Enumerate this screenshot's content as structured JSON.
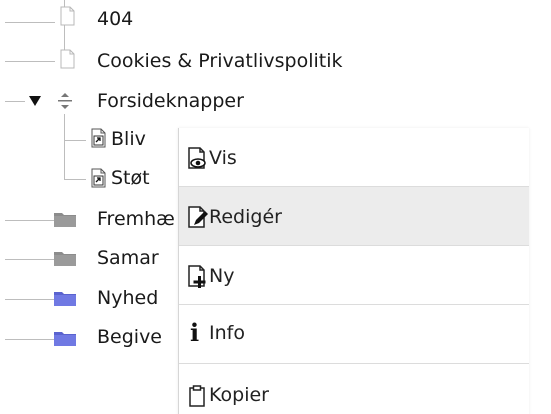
{
  "tree": {
    "items": [
      {
        "label": "404",
        "icon": "page-icon"
      },
      {
        "label": "Cookies & Privatlivspolitik",
        "icon": "page-icon"
      },
      {
        "label": "Forsideknapper",
        "icon": "sort-handle-icon",
        "expanded": true
      },
      {
        "label": "Bliv",
        "icon": "page-shortcut-icon"
      },
      {
        "label": "Støt",
        "icon": "page-shortcut-icon"
      },
      {
        "label": "Fremhæ",
        "icon": "folder-gray-icon"
      },
      {
        "label": "Samar",
        "icon": "folder-gray-icon"
      },
      {
        "label": "Nyhed",
        "icon": "folder-blue-icon"
      },
      {
        "label": "Begive",
        "icon": "folder-blue-icon"
      }
    ]
  },
  "context_menu": {
    "items": [
      {
        "label": "Vis",
        "icon": "view-page-icon"
      },
      {
        "label": "Redigér",
        "icon": "edit-page-icon",
        "hovered": true
      },
      {
        "label": "Ny",
        "icon": "new-page-icon"
      },
      {
        "label": "Info",
        "icon": "info-icon"
      },
      {
        "label": "Kopier",
        "icon": "clipboard-icon"
      }
    ]
  },
  "colors": {
    "tree_line": "#bdbdbd",
    "folder_gray": "#8c8c8c",
    "folder_blue": "#6f79e0",
    "hover_bg": "#ececec",
    "text": "#1a1a1a"
  }
}
